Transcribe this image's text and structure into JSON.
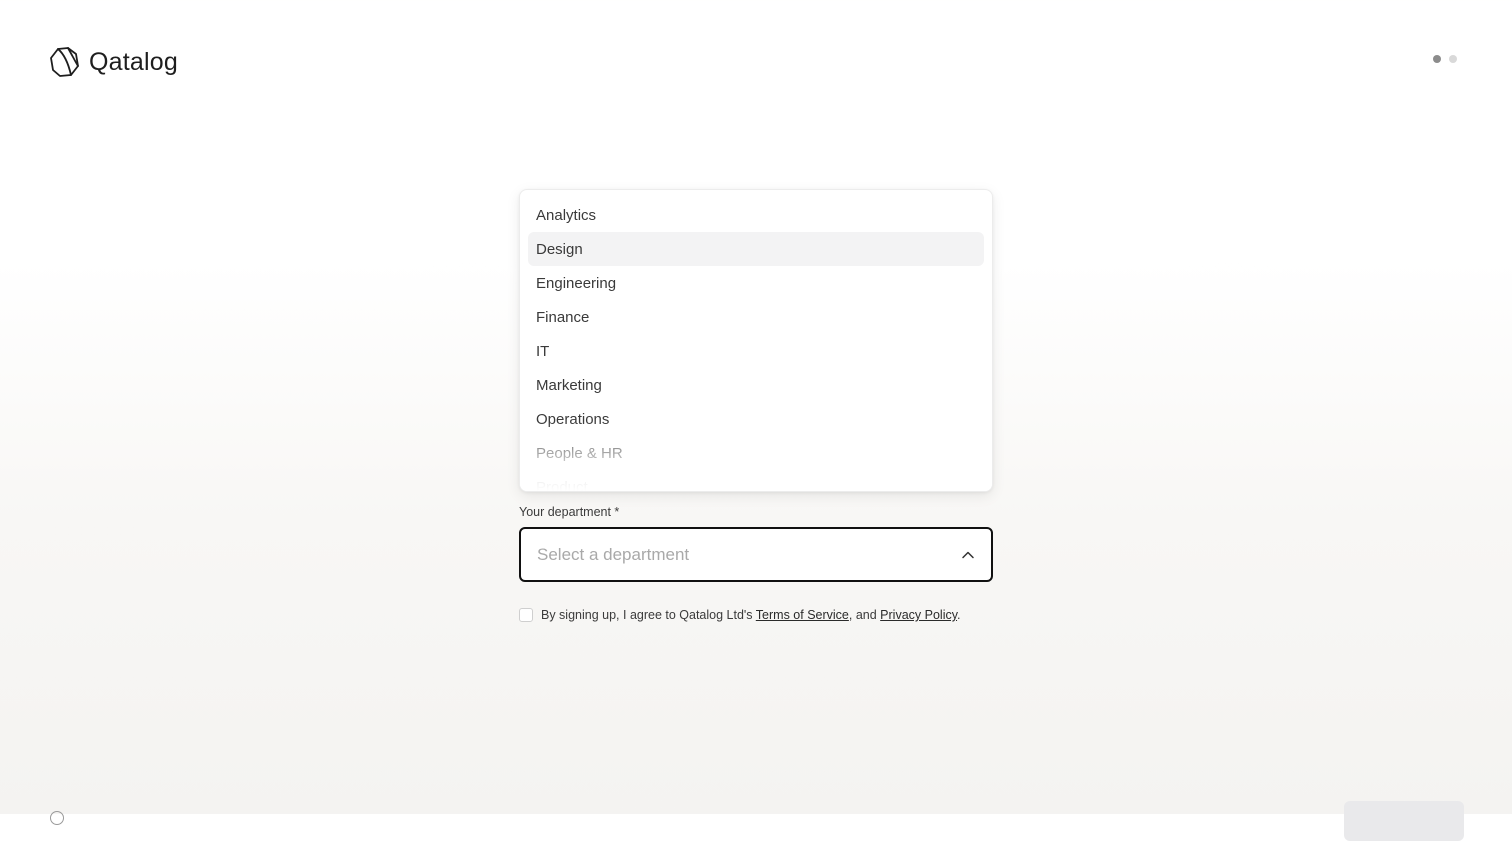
{
  "app": {
    "name": "Qatalog"
  },
  "stepper": {
    "total_steps": 2,
    "current_step": 1
  },
  "department_dropdown": {
    "options": [
      "Analytics",
      "Design",
      "Engineering",
      "Finance",
      "IT",
      "Marketing",
      "Operations",
      "People & HR",
      "Product"
    ],
    "highlighted_option": "Design"
  },
  "department_field": {
    "label": "Your department *",
    "placeholder": "Select a department",
    "value": ""
  },
  "agreement": {
    "checked": false,
    "text_before": "By signing up, I agree to Qatalog Ltd's ",
    "terms_link": "Terms of Service",
    "text_middle": ", and ",
    "privacy_link": "Privacy Policy",
    "text_after": "."
  },
  "icons": {
    "logo": "qatalog-logo-icon",
    "select_toggle": "chevron-up-icon"
  },
  "colors": {
    "dot_active": "#8c8c8c",
    "dot_inactive": "#d9d9d9",
    "highlight_bg": "#f3f3f4"
  }
}
